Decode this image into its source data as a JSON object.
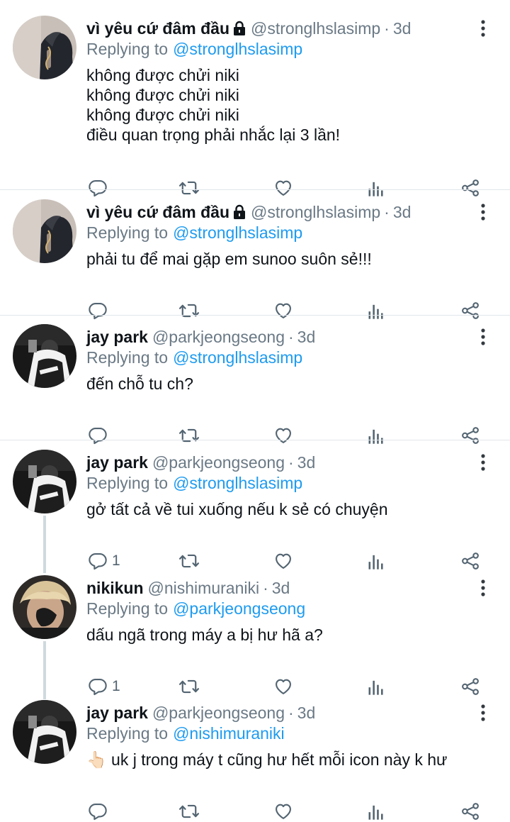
{
  "tweets": [
    {
      "name": "vì yêu cứ đâm đầu",
      "locked": true,
      "handle": "@stronglhslasimp",
      "dot": "·",
      "time": "3d",
      "replying_label": "Replying to",
      "replying_to": "@stronglhslasimp",
      "text": [
        "không được chửi niki",
        "không được chửi niki",
        "không được chửi niki",
        "điều quan trọng phải nhắc lại 3 lần!"
      ],
      "reply_count": ""
    },
    {
      "name": "vì yêu cứ đâm đầu",
      "locked": true,
      "handle": "@stronglhslasimp",
      "dot": "·",
      "time": "3d",
      "replying_label": "Replying to",
      "replying_to": "@stronglhslasimp",
      "text": [
        "phải tu để mai gặp em sunoo suôn sẻ!!!"
      ],
      "reply_count": ""
    },
    {
      "name": "jay park",
      "locked": false,
      "handle": "@parkjeongseong",
      "dot": "·",
      "time": "3d",
      "replying_label": "Replying to",
      "replying_to": "@stronglhslasimp",
      "text": [
        "đến chỗ tu ch?"
      ],
      "reply_count": ""
    },
    {
      "name": "jay park",
      "locked": false,
      "handle": "@parkjeongseong",
      "dot": "·",
      "time": "3d",
      "replying_label": "Replying to",
      "replying_to": "@stronglhslasimp",
      "text": [
        "gở tất cả về tui xuống nếu k sẻ có chuyện"
      ],
      "reply_count": "1"
    },
    {
      "name": "nikikun",
      "locked": false,
      "handle": "@nishimuraniki",
      "dot": "·",
      "time": "3d",
      "replying_label": "Replying to",
      "replying_to": "@parkjeongseong",
      "text": [
        "dấu ngã trong máy a bị hư hã a?"
      ],
      "reply_count": "1"
    },
    {
      "name": "jay park",
      "locked": false,
      "handle": "@parkjeongseong",
      "dot": "·",
      "time": "3d",
      "replying_label": "Replying to",
      "replying_to": "@nishimuraniki",
      "text": [
        "👆🏻 uk j trong máy t cũng hư hết mỗi icon này k hư"
      ],
      "reply_count": ""
    }
  ],
  "icons": {
    "lock": "lock-icon",
    "more": "more-vertical-icon",
    "reply": "reply-icon",
    "retweet": "retweet-icon",
    "like": "heart-icon",
    "analytics": "analytics-icon",
    "share": "share-icon"
  },
  "colors": {
    "link": "#1d9bf0",
    "secondary_text": "#6a7985",
    "icon": "#536471",
    "divider": "#e1e6ea",
    "thread_line": "#cfd9de"
  }
}
